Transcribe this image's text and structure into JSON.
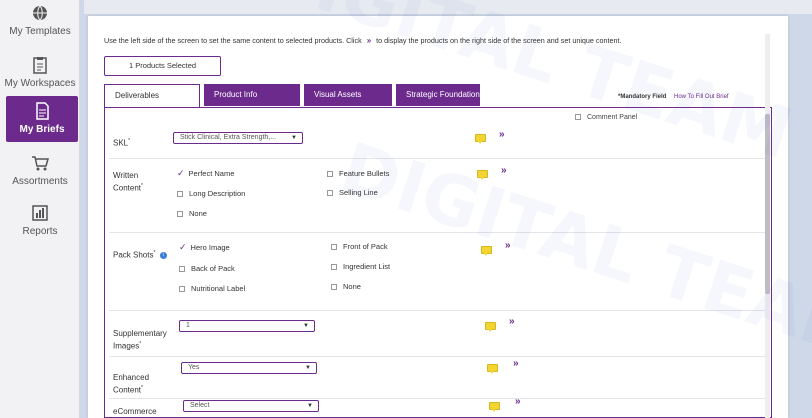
{
  "sidebar": {
    "items": [
      {
        "label": "My Templates",
        "icon": "globe-icon"
      },
      {
        "label": "My Workspaces",
        "icon": "clipboard-icon"
      },
      {
        "label": "My Briefs",
        "icon": "document-icon",
        "active": true
      },
      {
        "label": "Assortments",
        "icon": "cart-icon"
      },
      {
        "label": "Reports",
        "icon": "report-icon"
      }
    ]
  },
  "instructions": {
    "before": "Use the left side of the screen to set the same content to selected products. Click",
    "chevron": "»",
    "after": "to display the products on the right side of the screen and set unique content."
  },
  "selected_button": "1 Products Selected",
  "tabs": [
    {
      "label": "Deliverables",
      "active": true
    },
    {
      "label": "Product Info"
    },
    {
      "label": "Visual Assets"
    },
    {
      "label": "Strategic Foundation"
    }
  ],
  "mandatory": {
    "label": "*Mandatory Field",
    "link": "How To Fill Out Brief"
  },
  "comment_panel": "Comment Panel",
  "rows": {
    "skl": {
      "label": "SKL",
      "req": "*",
      "select": "Stick Clinical, Extra Strength,..."
    },
    "written": {
      "label_1": "Written",
      "label_2": "Content",
      "req": "*",
      "options": {
        "perfect_name": "Perfect Name",
        "feature_bullets": "Feature Bullets",
        "long_description": "Long Description",
        "selling_line": "Selling Line",
        "none": "None"
      }
    },
    "pack": {
      "label": "Pack Shots",
      "req": "*",
      "info": "i",
      "options": {
        "hero_image": "Hero Image",
        "front_of_pack": "Front of Pack",
        "back_of_pack": "Back of Pack",
        "ingredient_list": "Ingredient List",
        "nutritional_label": "Nutritional Label",
        "none": "None"
      }
    },
    "supplementary": {
      "label_1": "Supplementary",
      "label_2": "Images",
      "req": "*",
      "select": "1"
    },
    "enhanced": {
      "label_1": "Enhanced",
      "label_2": "Content",
      "req": "*",
      "select": "Yes"
    },
    "ecommerce": {
      "label_1": "eCommerce",
      "select": "Select"
    }
  },
  "watermark": "DIGITAL TEAM",
  "colors": {
    "accent": "#6b2a8c",
    "comment": "#f3d531",
    "info": "#3b7dd8"
  }
}
